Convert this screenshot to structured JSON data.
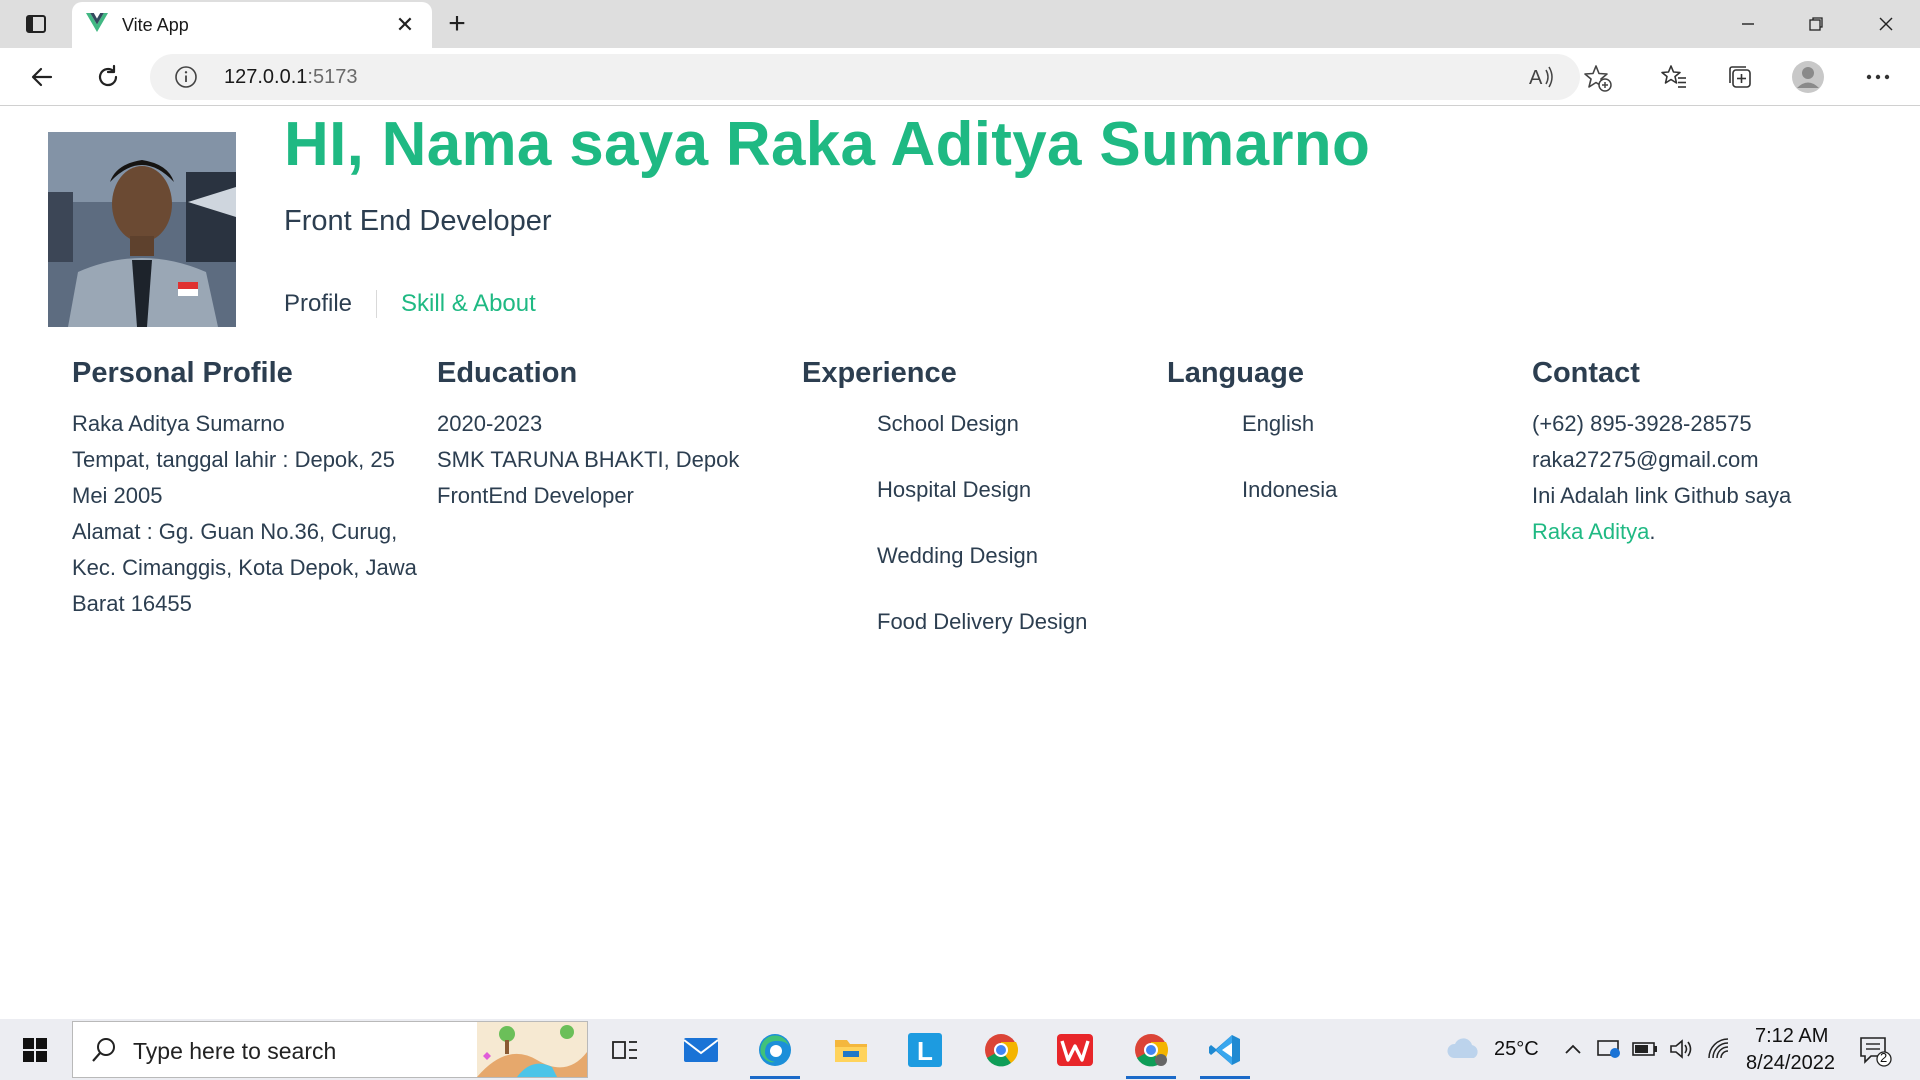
{
  "browser": {
    "tab_title": "Vite App",
    "url_host": "127.0.0.1",
    "url_port": ":5173",
    "icons": {
      "tab_actions": "tab-actions-icon",
      "close_tab": "close-icon",
      "new_tab": "plus-icon",
      "back": "arrow-left-icon",
      "refresh": "refresh-icon",
      "info": "info-icon",
      "read_aloud": "read-aloud-icon",
      "add_favorite": "star-plus-icon",
      "favorites": "favorites-icon",
      "collections": "collections-icon",
      "profile": "avatar",
      "menu": "more-icon"
    }
  },
  "hero": {
    "title": "HI, Nama saya Raka Aditya Sumarno",
    "subtitle": "Front End Developer",
    "nav": {
      "profile": "Profile",
      "skill_about": "Skill & About"
    }
  },
  "sections": {
    "personal": {
      "heading": "Personal Profile",
      "name": "Raka Aditya Sumarno",
      "birth": "Tempat, tanggal lahir : Depok, 25 Mei 2005",
      "address": "Alamat : Gg. Guan No.36, Curug, Kec. Cimanggis, Kota Depok, Jawa Barat 16455"
    },
    "education": {
      "heading": "Education",
      "years": "2020-2023",
      "school": "SMK TARUNA BHAKTI, Depok",
      "major": "FrontEnd Developer"
    },
    "experience": {
      "heading": "Experience",
      "items": [
        "School Design",
        "Hospital Design",
        "Wedding Design",
        "Food Delivery Design"
      ]
    },
    "language": {
      "heading": "Language",
      "items": [
        "English",
        "Indonesia"
      ]
    },
    "contact": {
      "heading": "Contact",
      "phone": "(+62) 895-3928-28575",
      "email": "raka27275@gmail.com",
      "github_text": "Ini Adalah link Github saya",
      "github_link": "Raka Aditya",
      "github_suffix": "."
    }
  },
  "taskbar": {
    "search_placeholder": "Type here to search",
    "temperature": "25°C",
    "time": "7:12 AM",
    "date": "8/24/2022",
    "notification_count": "2"
  },
  "colors": {
    "accent": "#1fb983",
    "text": "#2c3e50"
  }
}
